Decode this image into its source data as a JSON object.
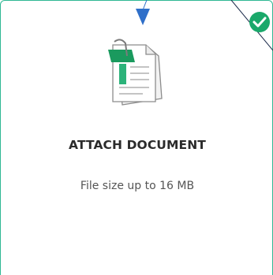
{
  "upload_card": {
    "title": "ATTACH DOCUMENT",
    "subtitle": "File size up to 16 MB",
    "selected": true
  },
  "icons": {
    "document": "attach-document-icon",
    "status": "check-circle-icon",
    "pointer": "cursor-arrow-icon"
  },
  "colors": {
    "accent": "#2fb893",
    "check": "#1aa86a",
    "clip": "#1a9a5e",
    "pointer": "#2f6fc9"
  }
}
